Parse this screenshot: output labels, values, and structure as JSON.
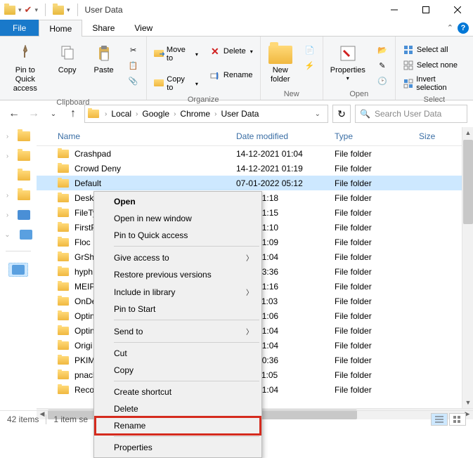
{
  "titlebar": {
    "title": "User Data"
  },
  "tabs": {
    "file": "File",
    "home": "Home",
    "share": "Share",
    "view": "View"
  },
  "ribbon": {
    "clipboard": {
      "label": "Clipboard",
      "pin": "Pin to Quick\naccess",
      "copy": "Copy",
      "paste": "Paste"
    },
    "organize": {
      "label": "Organize",
      "moveto": "Move to",
      "copyto": "Copy to",
      "delete": "Delete",
      "rename": "Rename"
    },
    "new": {
      "label": "New",
      "newfolder": "New\nfolder"
    },
    "open": {
      "label": "Open",
      "properties": "Properties"
    },
    "select": {
      "label": "Select",
      "all": "Select all",
      "none": "Select none",
      "invert": "Invert selection"
    }
  },
  "address": {
    "parts": [
      "Local",
      "Google",
      "Chrome",
      "User Data"
    ]
  },
  "search": {
    "placeholder": "Search User Data"
  },
  "columns": {
    "name": "Name",
    "date": "Date modified",
    "type": "Type",
    "size": "Size"
  },
  "rows": [
    {
      "name": "Crashpad",
      "date": "14-12-2021 01:04",
      "type": "File folder",
      "selected": false
    },
    {
      "name": "Crowd Deny",
      "date": "14-12-2021 01:19",
      "type": "File folder",
      "selected": false
    },
    {
      "name": "Default",
      "date": "07-01-2022 05:12",
      "type": "File folder",
      "selected": true
    },
    {
      "name": "Deskt",
      "date": "2021 01:18",
      "type": "File folder",
      "selected": false
    },
    {
      "name": "FileTy",
      "date": "2021 01:15",
      "type": "File folder",
      "selected": false
    },
    {
      "name": "FirstP",
      "date": "2021 01:10",
      "type": "File folder",
      "selected": false
    },
    {
      "name": "Floc",
      "date": "2021 01:09",
      "type": "File folder",
      "selected": false
    },
    {
      "name": "GrSha",
      "date": "2021 01:04",
      "type": "File folder",
      "selected": false
    },
    {
      "name": "hyph",
      "date": "2022 03:36",
      "type": "File folder",
      "selected": false
    },
    {
      "name": "MEIP",
      "date": "2021 01:16",
      "type": "File folder",
      "selected": false
    },
    {
      "name": "OnDe",
      "date": "2022 11:03",
      "type": "File folder",
      "selected": false
    },
    {
      "name": "Optin",
      "date": "2021 01:06",
      "type": "File folder",
      "selected": false
    },
    {
      "name": "Optin",
      "date": "2021 01:04",
      "type": "File folder",
      "selected": false
    },
    {
      "name": "Origi",
      "date": "2021 01:04",
      "type": "File folder",
      "selected": false
    },
    {
      "name": "PKIM",
      "date": "2022 10:36",
      "type": "File folder",
      "selected": false
    },
    {
      "name": "pnacl",
      "date": "2021 11:05",
      "type": "File folder",
      "selected": false
    },
    {
      "name": "Recov",
      "date": "2021 01:04",
      "type": "File folder",
      "selected": false
    }
  ],
  "ctxmenu": {
    "open": "Open",
    "newwin": "Open in new window",
    "pinqa": "Pin to Quick access",
    "giveaccess": "Give access to",
    "restore": "Restore previous versions",
    "include": "Include in library",
    "pinstart": "Pin to Start",
    "sendto": "Send to",
    "cut": "Cut",
    "copy": "Copy",
    "shortcut": "Create shortcut",
    "delete": "Delete",
    "rename": "Rename",
    "properties": "Properties"
  },
  "status": {
    "count": "42 items",
    "selected": "1 item se"
  }
}
